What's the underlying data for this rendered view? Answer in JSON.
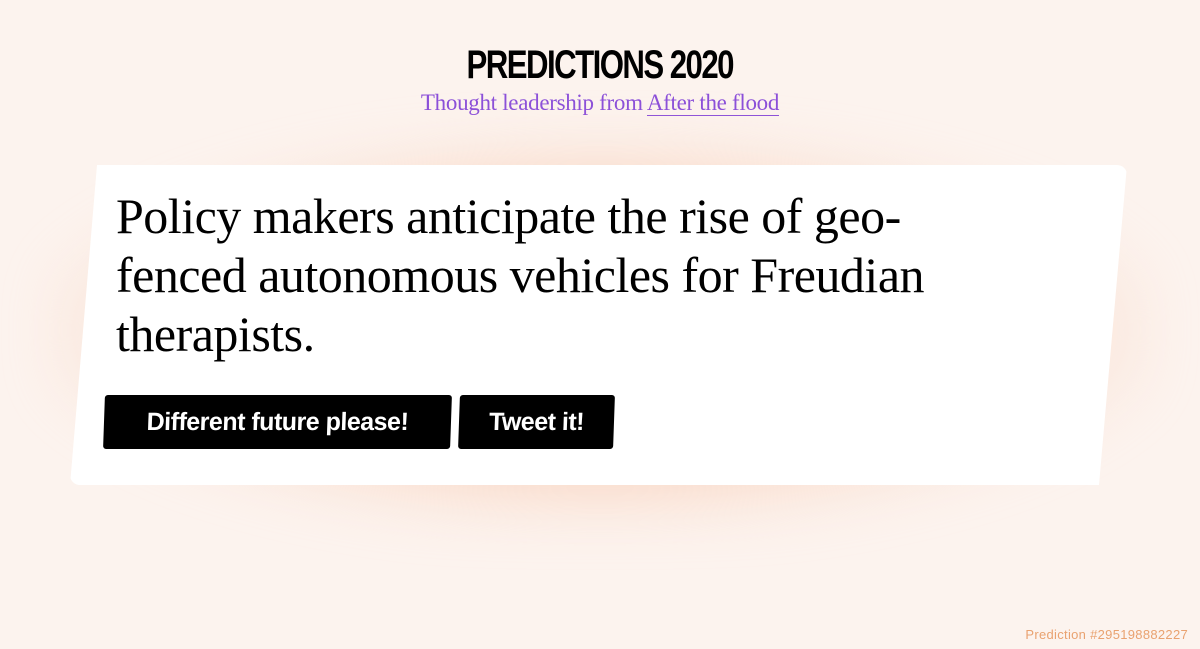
{
  "header": {
    "title": "PREDICTIONS 2020",
    "subtitle_prefix": "Thought leadership from ",
    "subtitle_link": "After the flood"
  },
  "card": {
    "prediction": "Policy makers anticipate the rise of geo-fenced autonomous vehicles for Freudian therapists.",
    "buttons": {
      "different_label": "Different future please!",
      "tweet_label": "Tweet it!"
    }
  },
  "footer": {
    "prediction_id": "Prediction #295198882227"
  },
  "colors": {
    "background": "#fcf3ee",
    "accent_purple": "#8b4fd9",
    "footer_orange": "#e9a270",
    "card_glow": "#f7c4aa",
    "button_bg": "#000000"
  }
}
